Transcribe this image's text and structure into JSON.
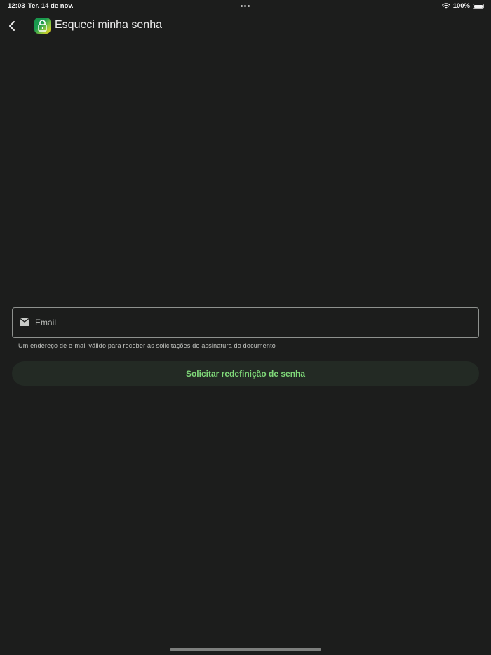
{
  "status_bar": {
    "time": "12:03",
    "date": "Ter. 14 de nov.",
    "battery": "100%"
  },
  "header": {
    "title": "Esqueci minha senha",
    "back_icon": "chevron-left-icon",
    "logo_icon": "padlock-app-icon"
  },
  "form": {
    "email": {
      "value": "",
      "placeholder": "Email",
      "icon": "mail-icon",
      "helper": "Um endereço de e-mail válido para receber as solicitações de assinatura do documento"
    },
    "submit_label": "Solicitar redefinição de senha"
  },
  "colors": {
    "background": "#1c1d1c",
    "accent_text": "#7fd879",
    "button_bg": "#232a24",
    "field_border": "#8e918e"
  }
}
